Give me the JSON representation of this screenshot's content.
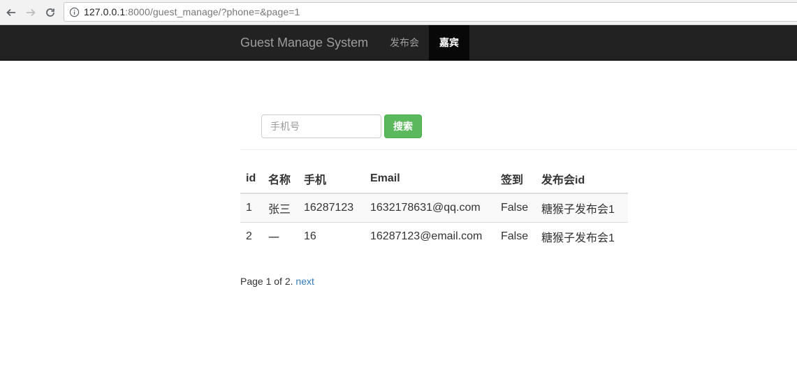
{
  "browser": {
    "url_host": "127.0.0.1",
    "url_rest": ":8000/guest_manage/?phone=&page=1"
  },
  "navbar": {
    "brand": "Guest Manage System",
    "items": [
      {
        "label": "发布会",
        "active": false
      },
      {
        "label": "嘉宾",
        "active": true
      }
    ]
  },
  "search": {
    "placeholder": "手机号",
    "value": "",
    "button_label": "搜索"
  },
  "table": {
    "columns": [
      "id",
      "名称",
      "手机",
      "Email",
      "签到",
      "发布会id"
    ],
    "rows": [
      [
        "1",
        "张三",
        "16287123",
        "1632178631@qq.com",
        "False",
        "糖猴子发布会1"
      ],
      [
        "2",
        "一",
        "16",
        "16287123@email.com",
        "False",
        "糖猴子发布会1"
      ]
    ]
  },
  "pagination": {
    "text": "Page 1 of 2.",
    "next_label": "next"
  },
  "colors": {
    "navbar_bg": "#222222",
    "active_bg": "#080808",
    "success": "#5cb85c",
    "link": "#337ab7"
  }
}
